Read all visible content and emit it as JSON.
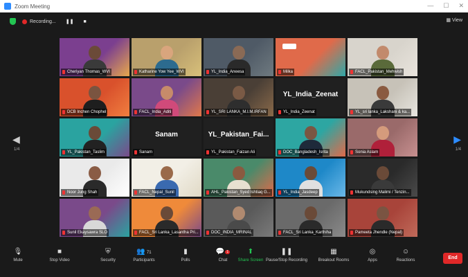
{
  "window": {
    "title": "Zoom Meeting"
  },
  "topbar": {
    "recording_label": "Recording...",
    "view_label": "View"
  },
  "nav": {
    "left_page": "1/4",
    "right_page": "1/4"
  },
  "participants": [
    {
      "name": "Cheriyan Thomas_WVI",
      "bg": "#7b3f8f",
      "accent": "#e8a84c",
      "skin": "#6b4a38",
      "shirt": "#3a3a3a"
    },
    {
      "name": "Katharine Yow Yee_WVI",
      "bg": "#b9a06c",
      "accent": "#d8c07a",
      "skin": "#d9a57d",
      "shirt": "#2c6b8f",
      "active": true
    },
    {
      "name": "YL_India_Aneesa",
      "bg": "#4f5a66",
      "accent": "#6f7a80",
      "skin": "#8a6a55",
      "shirt": "#2a2a2a"
    },
    {
      "name": "Milka",
      "bg": "#e06a4a",
      "accent": "#2fa8a8",
      "logo": true
    },
    {
      "name": "FACL_Pakistan_Mehwish",
      "bg": "#d8d4cc",
      "accent": "#e9e4dd",
      "skin": "#c28a6c",
      "shirt": "#5a6a3a"
    },
    {
      "name": "DCB Inchen Chophel",
      "bg": "#d9512c",
      "accent": "#f07e3f",
      "skin": "#7a5440",
      "shirt": "#1e1e1e"
    },
    {
      "name": "FACL_India_Aditi",
      "bg": "#7a4a8a",
      "accent": "#e0784a",
      "skin": "#c78b6a",
      "shirt": "#d04a7a"
    },
    {
      "name": "YL_SRI LANKA_M.I.M.IRFAN",
      "bg": "#4a3f36",
      "accent": "#8a6a4a",
      "skin": "#7a5a45",
      "shirt": "#2e2e2e"
    },
    {
      "name": "YL_India_Zeenat",
      "bg": "#202020",
      "big": "YL_India_Zeenat"
    },
    {
      "name": "YL_sri lanka_Lakshani & ka...",
      "bg": "#c7c2b8",
      "accent": "#e8e6e0",
      "skin": "#8a5a40",
      "shirt": "#3a3a3a"
    },
    {
      "name": "YL_Pakistan_Taslim",
      "bg": "#2aa3a0",
      "accent": "#7a4a8a",
      "skin": "#6a4a38",
      "shirt": "#222222"
    },
    {
      "name": "Sanam",
      "bg": "#202020",
      "big": "Sanam"
    },
    {
      "name": "YL_Pakistan_Faizan Ali",
      "bg": "#202020",
      "big": "YL_Pakistan_Fai..."
    },
    {
      "name": "DOC_Bangladesh_Isrita",
      "bg": "#2da6a2",
      "accent": "#e06a4a",
      "skin": "#7a5642",
      "shirt": "#1e2a3a"
    },
    {
      "name": "Sonia Aslam",
      "bg": "#9a6a6a",
      "accent": "#c79090",
      "skin": "#d49b7c",
      "shirt": "#b0203a"
    },
    {
      "name": "Noor Jung Shah",
      "bg": "#eaeaea",
      "accent": "#ffffff",
      "skin": "#8a5c45",
      "shirt": "#2a2a2a"
    },
    {
      "name": "FACL_Nepal_Sunil",
      "bg": "#f2efe6",
      "accent": "#e0d9c5",
      "skin": "#9a6a4a",
      "shirt": "#3a6ab0"
    },
    {
      "name": "AHL_Pakistan_Syed Ishtiaq G...",
      "bg": "#4a8a6a",
      "accent": "#e06a4a",
      "skin": "#8a5a40",
      "shirt": "#e8e0d0"
    },
    {
      "name": "YL_India_Jasdeep",
      "bg": "#1e88c8",
      "accent": "#6ab8e8",
      "skin": "#6a4a38",
      "shirt": "#e0e0e0"
    },
    {
      "name": "Mukundsing Malimi / Tenzin...",
      "bg": "#2a2a2a",
      "accent": "#4a4a4a",
      "skin": "#6a4a38",
      "shirt": "#3a3a3a"
    },
    {
      "name": "Sunil Ekaysawra SLO",
      "bg": "#7a4a8a",
      "accent": "#2aa3a0",
      "skin": "#9a6a55",
      "shirt": "#d8d8d8"
    },
    {
      "name": "FACL_Sri Lanka_Lasantha Pri...",
      "bg": "#ef8a3a",
      "accent": "#7a4a8a",
      "skin": "#6a4a38",
      "shirt": "#2a2a2a"
    },
    {
      "name": "DOC_INDIA_MRINAL",
      "bg": "#5a5a5a",
      "accent": "#7a7a7a",
      "skin": "#b08a70",
      "shirt": "#4a4a4a"
    },
    {
      "name": "FACL_Sri Lanka_Karthiha",
      "bg": "#6a6a6a",
      "accent": "#8a8a8a",
      "skin": "#6a4a38",
      "shirt": "#2a2a2a"
    },
    {
      "name": "Pameeta Jhendle (Nepal)",
      "bg": "#a8443a",
      "accent": "#c06a5a",
      "skin": "#7a5442",
      "shirt": "#2a2a2a"
    }
  ],
  "toolbar": {
    "items": [
      {
        "label": "Mute",
        "icon": "microphone-icon"
      },
      {
        "label": "Stop Video",
        "icon": "video-camera-icon"
      },
      {
        "label": "Security",
        "icon": "shield-icon"
      },
      {
        "label": "Participants",
        "icon": "participants-icon",
        "count": "71"
      },
      {
        "label": "Polls",
        "icon": "poll-icon"
      },
      {
        "label": "Chat",
        "icon": "chat-icon",
        "badge": "1"
      },
      {
        "label": "Share Screen",
        "icon": "share-screen-icon"
      },
      {
        "label": "Pause/Stop Recording",
        "icon": "recording-icon"
      },
      {
        "label": "Breakout Rooms",
        "icon": "breakout-rooms-icon"
      },
      {
        "label": "Apps",
        "icon": "apps-icon"
      },
      {
        "label": "Reactions",
        "icon": "reactions-icon"
      }
    ],
    "end_label": "End"
  },
  "colors": {
    "zoom_blue": "#2d8cff",
    "end_red": "#e02828",
    "share_green": "#23c552",
    "active_speaker": "#f4d23a"
  }
}
